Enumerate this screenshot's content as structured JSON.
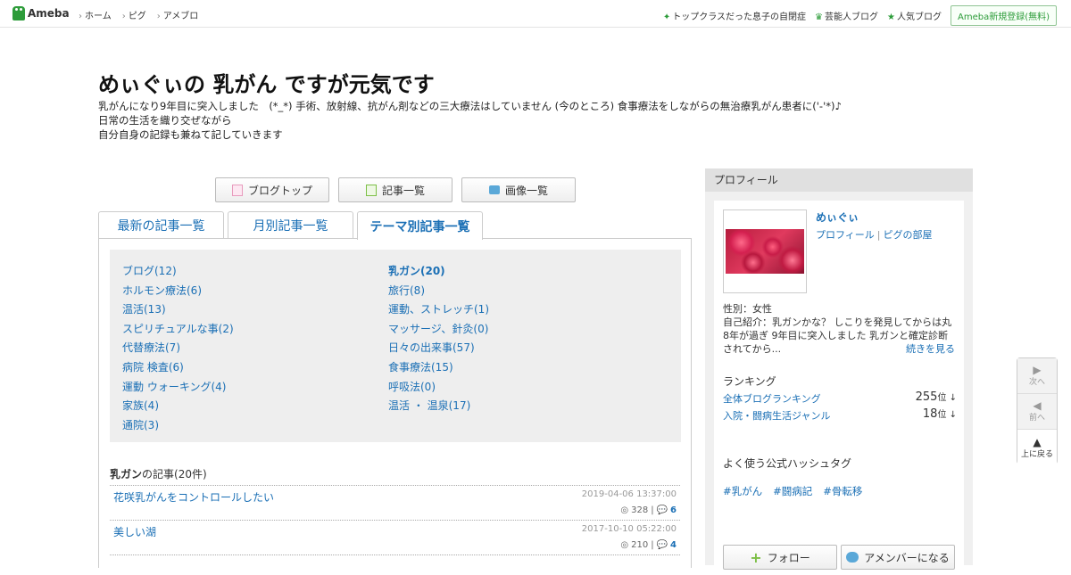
{
  "header": {
    "logo": "Ameba",
    "nav": [
      "ホーム",
      "ピグ",
      "アメブロ"
    ],
    "right_links": [
      "トップクラスだった息子の自閉症",
      "芸能人ブログ",
      "人気ブログ"
    ],
    "register": "Ameba新規登録(無料)"
  },
  "blog": {
    "title": "めぃぐぃの 乳がん ですが元気です",
    "desc1": "乳がんになり9年目に突入しました　(*_*) 手術、放射線、抗がん剤などの三大療法はしていません (今のところ) 食事療法をしながらの無治療乳がん患者に('-'*)♪",
    "desc2": "日常の生活を織り交ぜながら",
    "desc3": "自分自身の記録も兼ねて記していきます"
  },
  "buttons": {
    "top": "ブログトップ",
    "list": "記事一覧",
    "images": "画像一覧"
  },
  "tabs": [
    "最新の記事一覧",
    "月別記事一覧",
    "テーマ別記事一覧"
  ],
  "themes_left": [
    "ブログ(12)",
    "ホルモン療法(6)",
    "温活(13)",
    "スピリチュアルな事(2)",
    "代替療法(7)",
    "病院 検査(6)",
    "運動 ウォーキング(4)",
    "家族(4)",
    "通院(3)"
  ],
  "themes_right": [
    "乳ガン(20)",
    "旅行(8)",
    "運動、ストレッチ(1)",
    "マッサージ、針灸(0)",
    "日々の出来事(57)",
    "食事療法(15)",
    "呼吸法(0)",
    "温活 ・ 温泉(17)"
  ],
  "section": {
    "theme": "乳ガン",
    "rest": "の記事(20件)"
  },
  "entries": [
    {
      "title": "花咲乳がんをコントロールしたい",
      "date": "2019-04-06 13:37:00",
      "views": "328",
      "comments": "6"
    },
    {
      "title": "美しい湖",
      "date": "2017-10-10 05:22:00",
      "views": "210",
      "comments": "4"
    }
  ],
  "profile": {
    "heading": "プロフィール",
    "name": "めぃぐぃ",
    "link1": "プロフィール",
    "link2": "ピグの部屋",
    "gender": "性別：女性",
    "intro": "自己紹介：乳ガンかな？ しこりを発見してからは丸8年が過ぎ 9年目に突入しました 乳ガンと確定診断されてから...",
    "more": "続きを見る"
  },
  "ranking": {
    "heading": "ランキング",
    "items": [
      {
        "label": "全体ブログランキング",
        "num": "255",
        "unit": "位 ↓"
      },
      {
        "label": "入院・闘病生活ジャンル",
        "num": "18",
        "unit": "位 ↓"
      }
    ]
  },
  "hashtags": {
    "heading": "よく使う公式ハッシュタグ",
    "tags": [
      "#乳がん",
      "#闘病記",
      "#骨転移"
    ]
  },
  "follow": {
    "follow": "フォロー",
    "member": "アメンバーになる"
  },
  "pager": {
    "next": "次へ",
    "prev": "前へ",
    "top": "上に戻る"
  }
}
